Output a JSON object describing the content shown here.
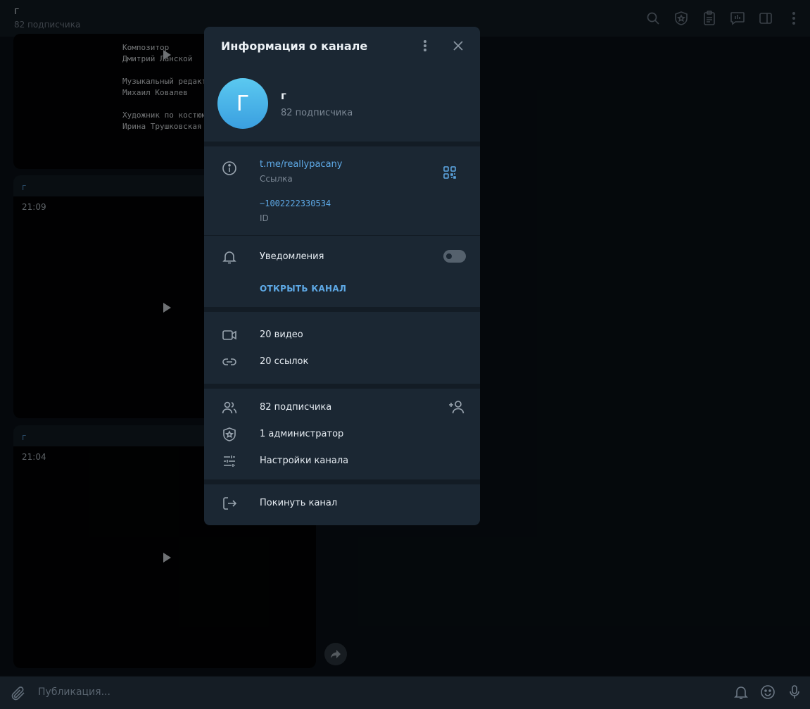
{
  "header": {
    "title": "г",
    "subtitle": "82 подписчика",
    "icons": [
      "search-icon",
      "admin-shield-icon",
      "clipboard-icon",
      "stats-icon",
      "sidebar-toggle-icon",
      "more-vertical-icon"
    ]
  },
  "chat": {
    "credits_text": "Композитор\nДмитрий Ланской\n\nМузыкальный редактор\nМихаил Ковалев\n\nХудожник по костюмам\nИрина Трушковская",
    "messages": [
      {
        "sender": "г",
        "time": "21:09"
      },
      {
        "sender": "г",
        "time": "21:04"
      }
    ]
  },
  "composer": {
    "placeholder": "Публикация..."
  },
  "dialog": {
    "title": "Информация о канале",
    "channel_name": "г",
    "avatar_letter": "Г",
    "channel_sub": "82 подписчика",
    "link": "t.me/reallypacany",
    "link_label": "Ссылка",
    "id_value": "−1002222330534",
    "id_label": "ID",
    "notifications_label": "Уведомления",
    "notifications_on": false,
    "open_channel": "ОТКРЫТЬ КАНАЛ",
    "media": [
      {
        "icon": "video-icon",
        "label": "20 видео"
      },
      {
        "icon": "link-icon",
        "label": "20 ссылок"
      }
    ],
    "members": [
      {
        "icon": "users-icon",
        "label": "82 подписчика"
      },
      {
        "icon": "admin-shield-icon",
        "label": "1 администратор"
      },
      {
        "icon": "settings-sliders-icon",
        "label": "Настройки канала"
      }
    ],
    "leave": "Покинуть канал"
  },
  "colors": {
    "accent": "#5ea9e6",
    "dialog_bg": "#1b2733",
    "avatar_gradient": [
      "#5bc9f0",
      "#3a9fe0"
    ]
  }
}
